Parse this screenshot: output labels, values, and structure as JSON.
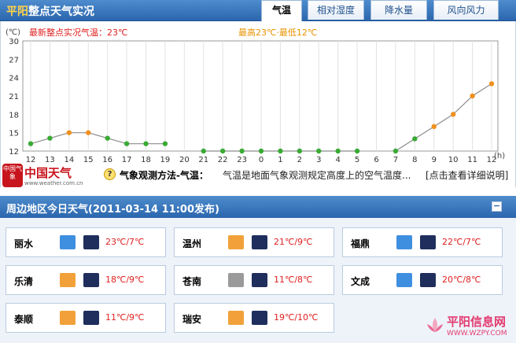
{
  "header": {
    "city": "平阳",
    "title_rest": "整点天气实况",
    "tabs": [
      {
        "label": "气温",
        "active": true
      },
      {
        "label": "相对湿度",
        "active": false
      },
      {
        "label": "降水量",
        "active": false
      },
      {
        "label": "风向风力",
        "active": false
      }
    ]
  },
  "chart": {
    "current_label": "最新整点实况气温：23℃",
    "range_label": "最高23℃·最低12℃",
    "unit_y": "(℃)",
    "unit_x": "(h)"
  },
  "chart_data": {
    "type": "line",
    "x": [
      "12",
      "13",
      "14",
      "15",
      "16",
      "17",
      "18",
      "19",
      "20",
      "21",
      "22",
      "23",
      "0",
      "1",
      "2",
      "3",
      "4",
      "5",
      "6",
      "7",
      "8",
      "9",
      "10",
      "11",
      "12"
    ],
    "y_ticks": [
      12,
      15,
      18,
      21,
      24,
      27,
      30
    ],
    "ylim": [
      12,
      30
    ],
    "series": [
      {
        "values": [
          13.2,
          14.1,
          15.0,
          15.0,
          14.1,
          13.2,
          13.2,
          13.2,
          null,
          12.0,
          12.0,
          12.0,
          12.0,
          12.0,
          12.0,
          12.0,
          12.0,
          12.0,
          null,
          12.0,
          14.0,
          16.0,
          18.0,
          21.0,
          23.0
        ]
      }
    ],
    "point_colors": [
      "#3aaa35",
      "#3aaa35",
      "#f0901e",
      "#f0901e",
      "#3aaa35",
      "#3aaa35",
      "#3aaa35",
      "#3aaa35",
      null,
      "#3aaa35",
      "#3aaa35",
      "#3aaa35",
      "#3aaa35",
      "#3aaa35",
      "#3aaa35",
      "#3aaa35",
      "#3aaa35",
      "#3aaa35",
      null,
      "#3aaa35",
      "#3aaa35",
      "#f0901e",
      "#f0901e",
      "#f0901e",
      "#f0901e"
    ],
    "grid": "vertical"
  },
  "info": {
    "logo_seal": "中国气象",
    "logo_name": "中国天气",
    "logo_url": "www.weather.com.cn",
    "label": "气象观测方法-气温：",
    "text": "气温是地面气象观测规定高度上的空气温度...",
    "link": "[点击查看详细说明]"
  },
  "forecast": {
    "title": "周边地区今日天气(2011-03-14  11:00发布)",
    "collapse_label": "−",
    "cities": [
      {
        "name": "丽水",
        "day_icon": "cloud-rain-icon",
        "night_icon": "night-rain-icon",
        "temp": "23℃/7℃"
      },
      {
        "name": "温州",
        "day_icon": "cloud-sun-icon",
        "night_icon": "night-rain-icon",
        "temp": "21℃/9℃"
      },
      {
        "name": "福鼎",
        "day_icon": "cloud-rain-icon",
        "night_icon": "night-rain-icon",
        "temp": "22℃/7℃"
      },
      {
        "name": "乐清",
        "day_icon": "cloud-sun-icon",
        "night_icon": "night-rain-icon",
        "temp": "18℃/9℃"
      },
      {
        "name": "苍南",
        "day_icon": "overcast-icon",
        "night_icon": "night-rain-icon",
        "temp": "11℃/8℃"
      },
      {
        "name": "文成",
        "day_icon": "cloud-rain-icon",
        "night_icon": "night-rain-icon",
        "temp": "20℃/8℃"
      },
      {
        "name": "泰顺",
        "day_icon": "cloud-sun-icon",
        "night_icon": "night-rain-icon",
        "temp": "11℃/9℃"
      },
      {
        "name": "瑞安",
        "day_icon": "cloud-sun-icon",
        "night_icon": "night-rain-icon",
        "temp": "19℃/10℃"
      }
    ]
  },
  "watermark": {
    "title": "平阳信息网",
    "url": "WWW.WZPY.COM"
  }
}
